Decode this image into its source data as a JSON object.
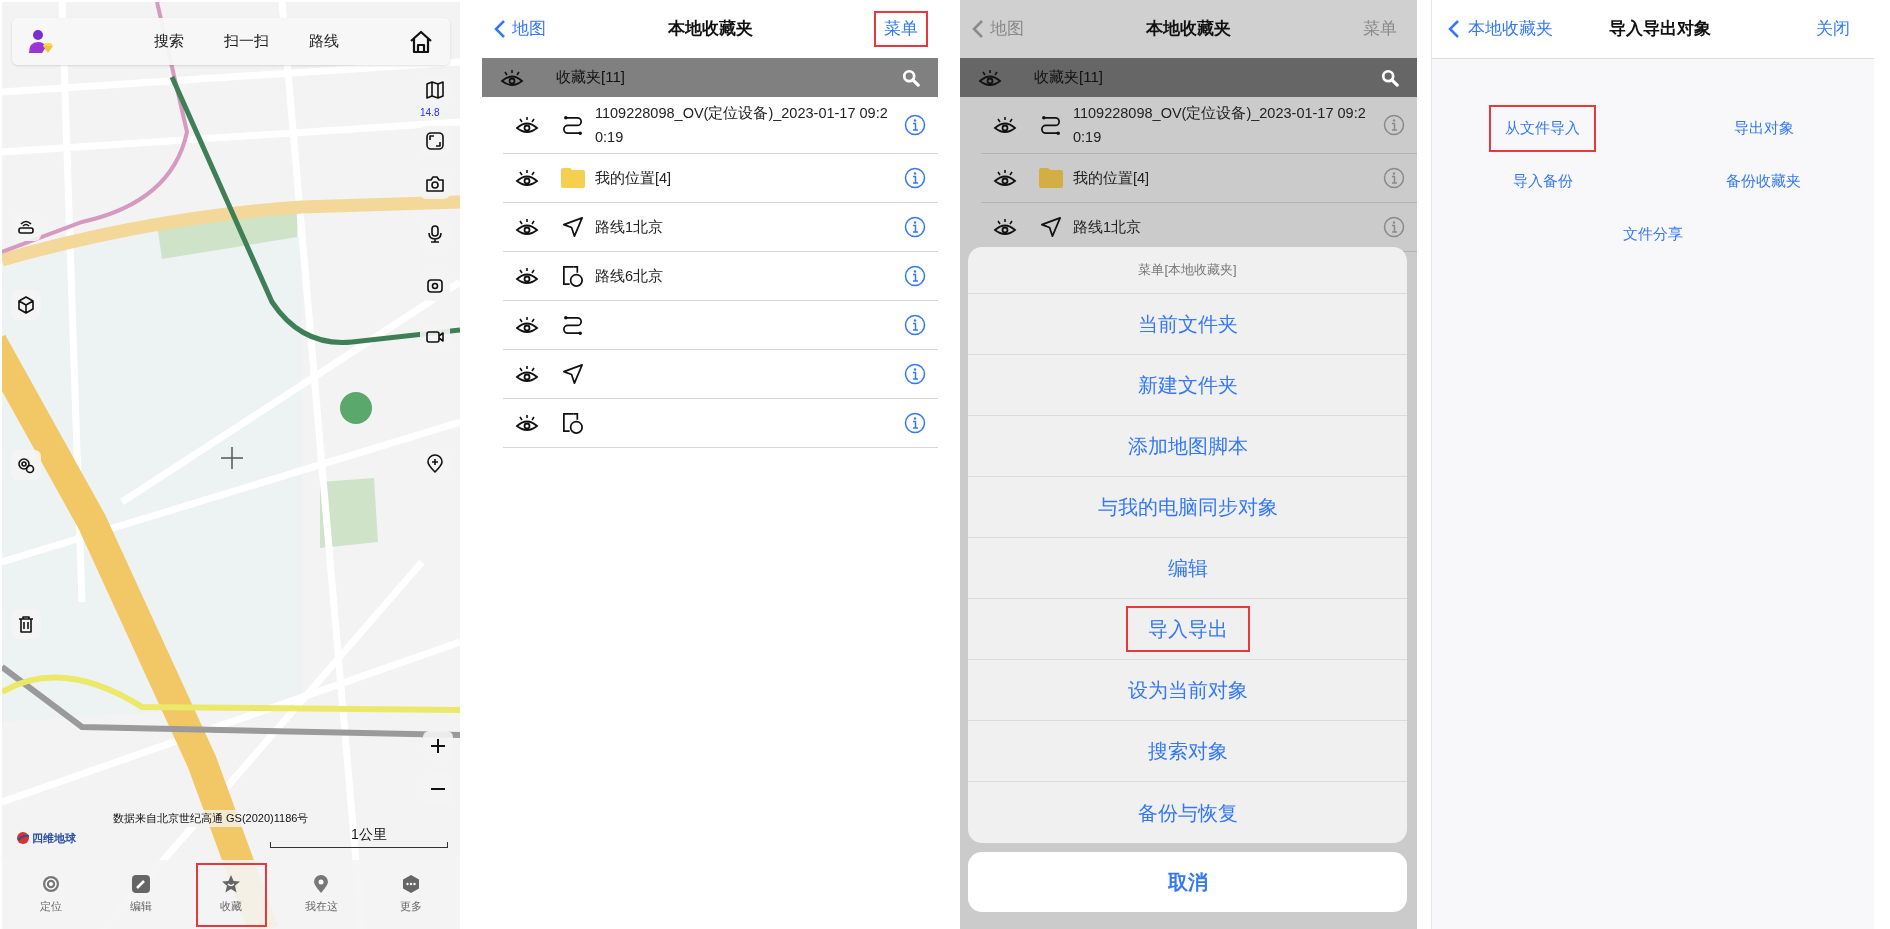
{
  "map_screen": {
    "top_links": [
      {
        "label": "搜索"
      },
      {
        "label": "扫一扫"
      },
      {
        "label": "路线"
      }
    ],
    "zoom_level": "14.8",
    "attribution": "数据来自北京世纪高通 GS(2020)1186号",
    "logo_text": "四维地球",
    "scale_label": "1公里",
    "tabs": [
      {
        "kind": "locate",
        "label": "定位",
        "highlighted": false
      },
      {
        "kind": "edit",
        "label": "编辑",
        "highlighted": false
      },
      {
        "kind": "favorites",
        "label": "收藏",
        "highlighted": true
      },
      {
        "kind": "here",
        "label": "我在这",
        "highlighted": false
      },
      {
        "kind": "more",
        "label": "更多",
        "highlighted": false
      }
    ]
  },
  "favorites_screen": {
    "nav": {
      "back": "地图",
      "title": "本地收藏夹",
      "action": "菜单",
      "action_highlighted": true
    },
    "header": "收藏夹[11]",
    "rows": [
      {
        "kind": "track",
        "label": "1109228098_OV(定位设备)_2023-01-17 09:20:19"
      },
      {
        "kind": "folder",
        "label": "我的位置[4]"
      },
      {
        "kind": "route",
        "label": "路线1北京"
      },
      {
        "kind": "area",
        "label": "路线6北京"
      },
      {
        "kind": "track"
      },
      {
        "kind": "route"
      },
      {
        "kind": "area"
      }
    ]
  },
  "menu_screen": {
    "nav": {
      "back": "地图",
      "title": "本地收藏夹",
      "action": "菜单",
      "action_highlighted": false
    },
    "header": "收藏夹[11]",
    "rows": [
      {
        "kind": "track",
        "label": "1109228098_OV(定位设备)_2023-01-17 09:20:19"
      },
      {
        "kind": "folder",
        "label": "我的位置[4]"
      },
      {
        "kind": "route",
        "label": "路线1北京"
      }
    ],
    "sheet": {
      "title": "菜单[本地收藏夹]",
      "items": [
        {
          "label": "当前文件夹",
          "highlighted": false
        },
        {
          "label": "新建文件夹",
          "highlighted": false
        },
        {
          "label": "添加地图脚本",
          "highlighted": false
        },
        {
          "label": "与我的电脑同步对象",
          "highlighted": false
        },
        {
          "label": "编辑",
          "highlighted": false
        },
        {
          "label": "导入导出",
          "highlighted": true
        },
        {
          "label": "设为当前对象",
          "highlighted": false
        },
        {
          "label": "搜索对象",
          "highlighted": false
        },
        {
          "label": "备份与恢复",
          "highlighted": false
        }
      ],
      "cancel": "取消"
    }
  },
  "import_export_screen": {
    "nav": {
      "back": "本地收藏夹",
      "title": "导入导出对象",
      "action": "关闭"
    },
    "options": [
      {
        "label": "从文件导入",
        "highlighted": true
      },
      {
        "label": "导出对象",
        "highlighted": false
      },
      {
        "label": "导入备份",
        "highlighted": false
      },
      {
        "label": "备份收藏夹",
        "highlighted": false
      },
      {
        "label": "文件分享",
        "highlighted": false
      }
    ]
  }
}
